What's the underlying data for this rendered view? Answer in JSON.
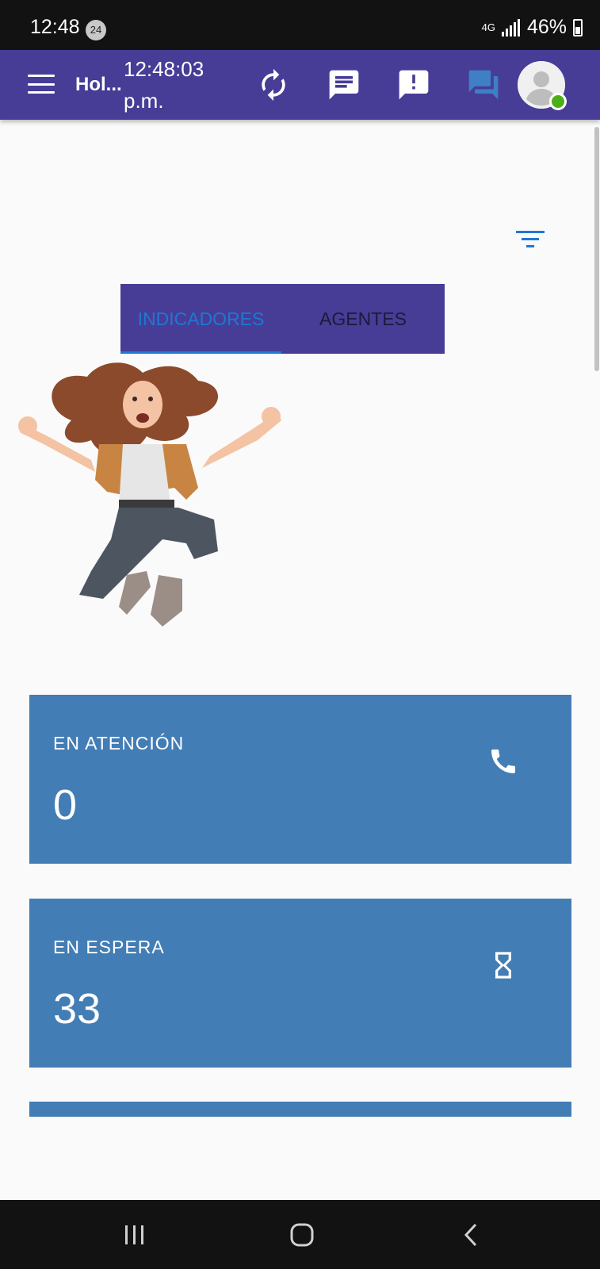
{
  "status_bar": {
    "time": "12:48",
    "notification_badge": "24",
    "network": "4G",
    "battery": "46%"
  },
  "app_bar": {
    "title": "Hol...",
    "clock_line1": "12:48:03",
    "clock_line2": "p.m.",
    "icons": [
      "menu-icon",
      "refresh-icon",
      "message-icon",
      "alert-message-icon",
      "forum-icon",
      "avatar"
    ],
    "status_color": "#4caf1a"
  },
  "tabs": [
    {
      "label": "INDICADORES",
      "active": true
    },
    {
      "label": "AGENTES",
      "active": false
    }
  ],
  "cards": [
    {
      "label": "EN ATENCIÓN",
      "value": "0",
      "icon": "phone-icon"
    },
    {
      "label": "EN ESPERA",
      "value": "33",
      "icon": "hourglass-icon"
    }
  ],
  "colors": {
    "primary": "#473d96",
    "card": "#437db5",
    "accent": "#1e78d4",
    "background": "#fafafa"
  },
  "nav_bar": {
    "buttons": [
      "recent-apps-icon",
      "home-icon",
      "back-icon"
    ]
  }
}
